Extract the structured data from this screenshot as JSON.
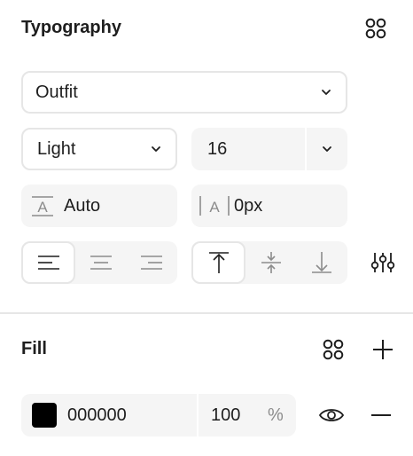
{
  "typography": {
    "title": "Typography",
    "styles_icon": "grid-styles-icon",
    "font_family": "Outfit",
    "font_weight": "Light",
    "font_size": "16",
    "line_height_value": "Auto",
    "letter_spacing_value": "0px",
    "text_align_options": [
      "align-left",
      "align-center",
      "align-right"
    ],
    "text_align_selected": "align-left",
    "vertical_align_options": [
      "align-top",
      "align-middle",
      "align-bottom"
    ],
    "vertical_align_selected": "align-top",
    "settings_icon": "type-settings-icon"
  },
  "fill": {
    "title": "Fill",
    "color_hex": "000000",
    "swatch_color": "#000000",
    "opacity": "100",
    "opacity_unit": "%",
    "visibility_icon": "eye-icon",
    "remove_icon": "minus-icon",
    "add_icon": "plus-icon",
    "styles_icon": "grid-styles-icon"
  },
  "colors": {
    "text": "#1e1e1e",
    "muted": "#8c8c8c",
    "field_bg": "#f5f5f5",
    "border": "#e6e6e6"
  }
}
